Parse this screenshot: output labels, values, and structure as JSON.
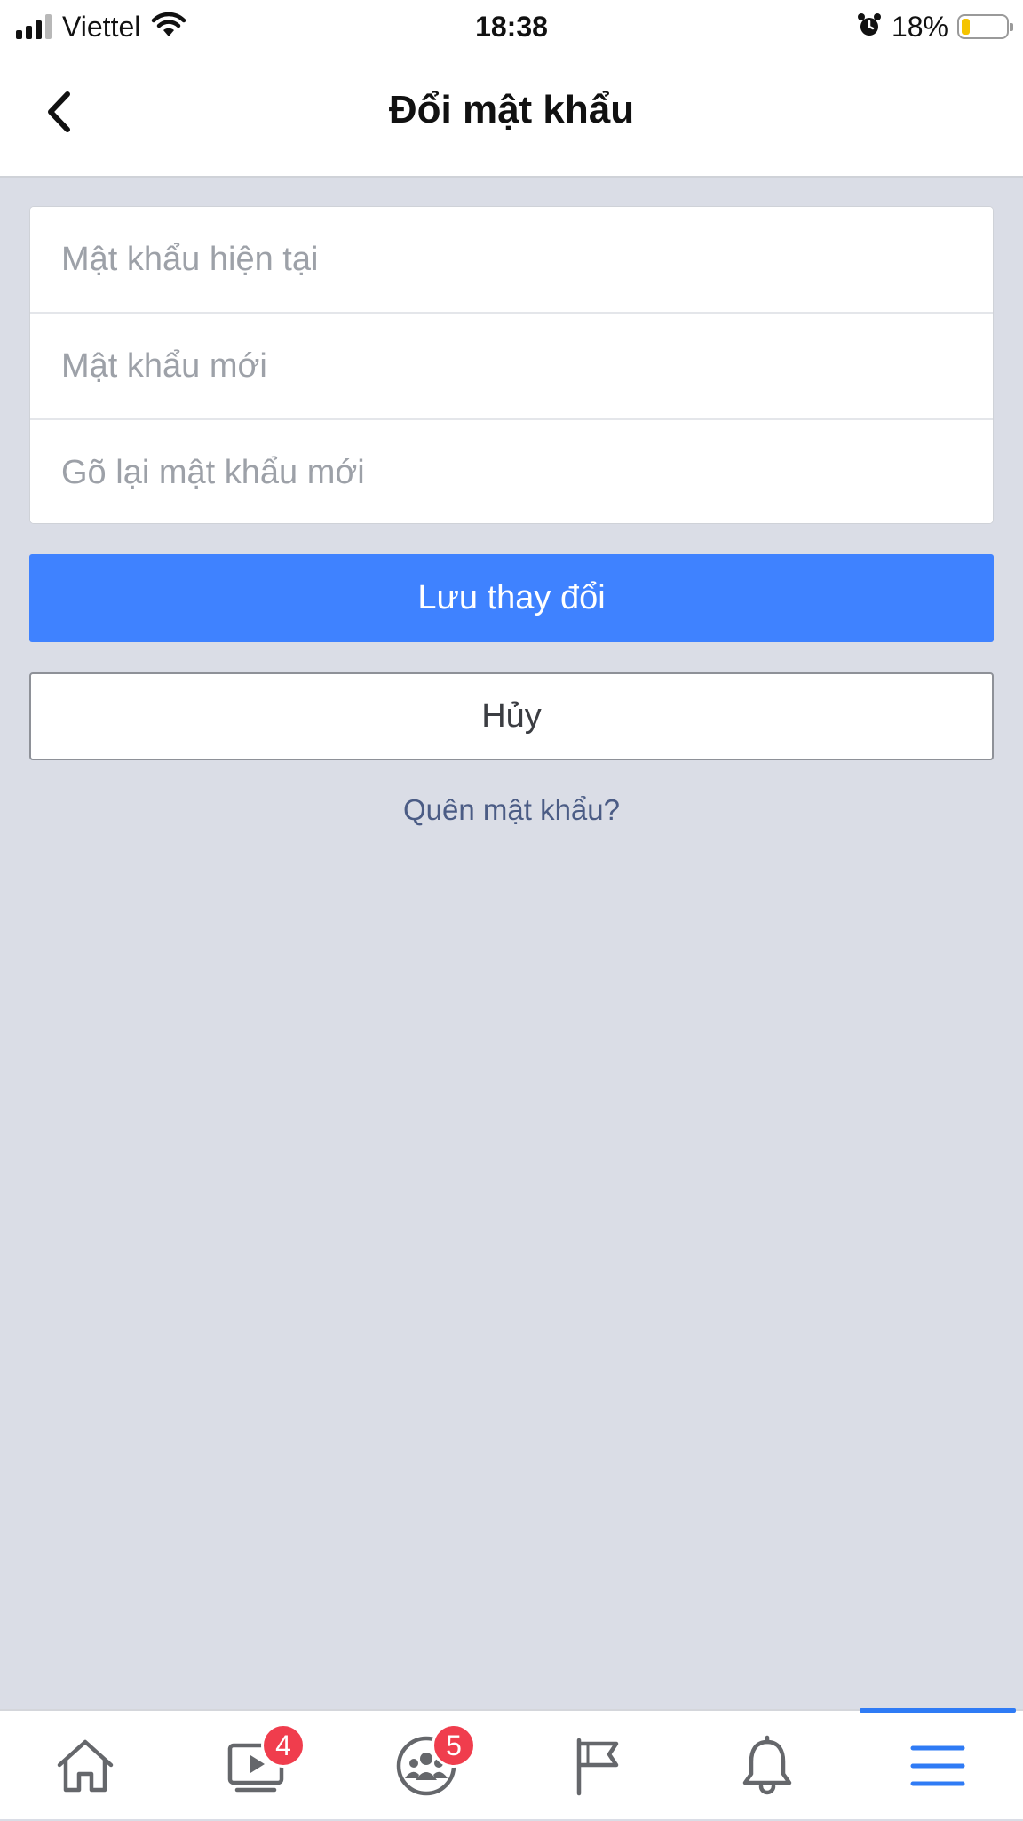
{
  "status_bar": {
    "carrier": "Viettel",
    "time": "18:38",
    "battery_percent": "18%",
    "battery_level": 0.18,
    "signal_bars": 4,
    "signal_bars_active": 3,
    "icons": [
      "signal-icon",
      "wifi-icon",
      "alarm-icon",
      "battery-icon"
    ]
  },
  "nav": {
    "title": "Đổi mật khẩu",
    "back_icon": "chevron-left-icon"
  },
  "form": {
    "current_password": {
      "placeholder": "Mật khẩu hiện tại",
      "value": ""
    },
    "new_password": {
      "placeholder": "Mật khẩu mới",
      "value": ""
    },
    "confirm_password": {
      "placeholder": "Gõ lại mật khẩu mới",
      "value": ""
    }
  },
  "actions": {
    "save_label": "Lưu thay đổi",
    "cancel_label": "Hủy",
    "forgot_label": "Quên mật khẩu?"
  },
  "tabs": [
    {
      "icon": "home-icon",
      "badge": ""
    },
    {
      "icon": "video-icon",
      "badge": "4"
    },
    {
      "icon": "groups-icon",
      "badge": "5"
    },
    {
      "icon": "pages-flag-icon",
      "badge": ""
    },
    {
      "icon": "bell-icon",
      "badge": ""
    },
    {
      "icon": "menu-icon",
      "badge": "",
      "active": true
    }
  ],
  "colors": {
    "background": "#dadde6",
    "primary": "#3f82ff",
    "link": "#4b5c85",
    "badge": "#f03d4d",
    "tab_active": "#2f7bf5",
    "icon": "#65676b"
  }
}
